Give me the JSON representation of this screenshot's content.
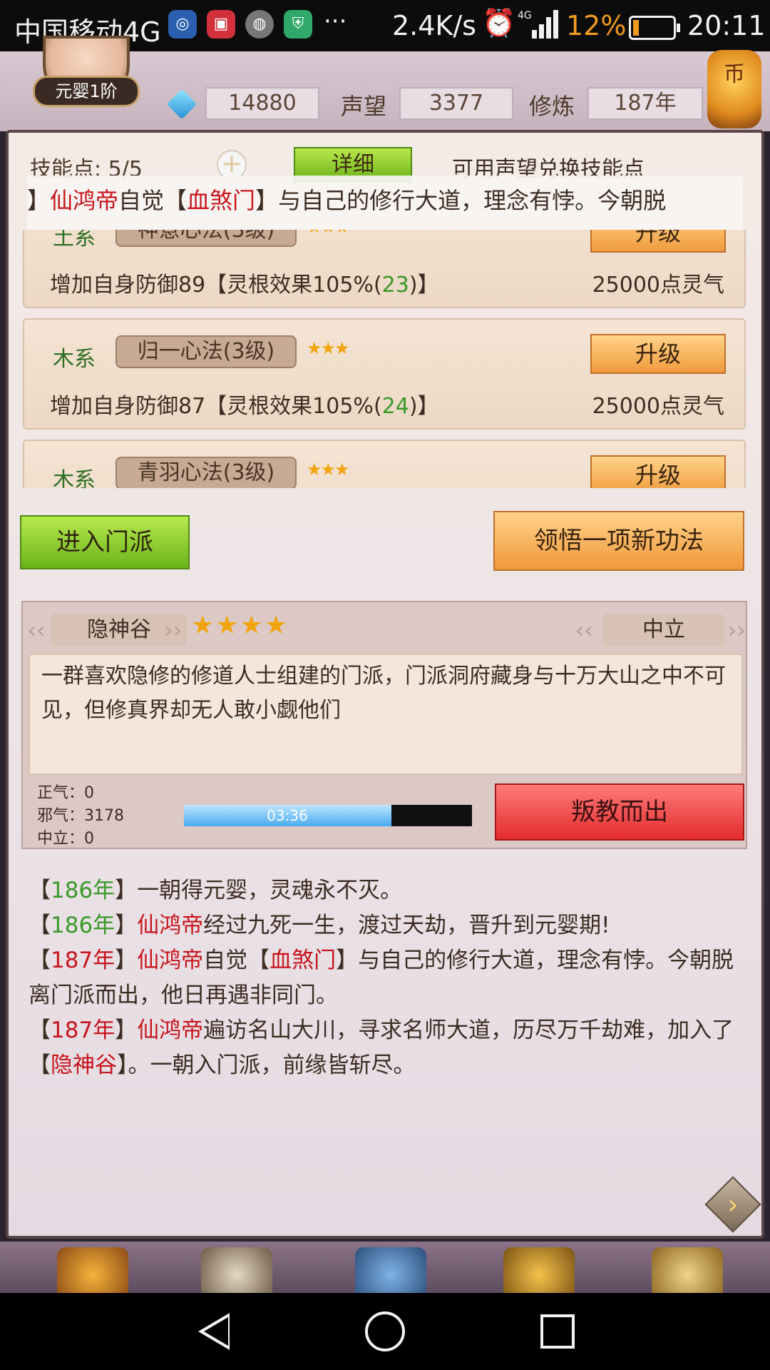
{
  "statusbar": {
    "carrier": "中国移动4G",
    "speed": "2.4K/s",
    "dots": "···",
    "net": "4G",
    "battery": "12%",
    "time": "20:11"
  },
  "topbar": {
    "rank": "元婴1阶",
    "gems": "14880",
    "prestige_label": "声望",
    "prestige": "3377",
    "cultivation_label": "修炼",
    "cultivation": "187年",
    "lantern": "币"
  },
  "skills_header": {
    "points": "技能点: 5/5",
    "detail_button": "详细",
    "exchange": "可用声望兑换技能点"
  },
  "ticker": {
    "lead": "】",
    "name": "仙鸿帝",
    "mid": "自觉【",
    "sect": "血煞门",
    "tail": "】与自己的修行大道，理念有悖。今朝脱"
  },
  "skills": [
    {
      "element": "土系",
      "name": "神意心法(3级)",
      "stars": "★★★",
      "upgrade": "升级",
      "effect_prefix": "增加自身防御89【灵根效果105%(",
      "effect_value": "23",
      "effect_suffix": ")】",
      "cost": "25000点灵气"
    },
    {
      "element": "木系",
      "name": "归一心法(3级)",
      "stars": "★★★",
      "upgrade": "升级",
      "effect_prefix": "增加自身防御87【灵根效果105%(",
      "effect_value": "24",
      "effect_suffix": ")】",
      "cost": "25000点灵气"
    },
    {
      "element": "木系",
      "name": "青羽心法(3级)",
      "stars": "★★★",
      "upgrade": "升级",
      "effect_prefix": "",
      "effect_value": "",
      "effect_suffix": "",
      "cost": ""
    }
  ],
  "actions": {
    "enter_sect": "进入门派",
    "learn": "领悟一项新功法",
    "betray": "叛教而出"
  },
  "sect": {
    "name": "隐神谷",
    "stars": "★★★★",
    "alignment": "中立",
    "description": "一群喜欢隐修的修道人士组建的门派，门派洞府藏身与十万大山之中不可见，但修真界却无人敢小觑他们",
    "righteous": "正气：0",
    "evil": "邪气：3178",
    "neutral": "中立：0",
    "timer": "03:36",
    "timer_progress": 0.72
  },
  "log": [
    {
      "l": "【",
      "year": "186年",
      "r": "】",
      "parts": [
        {
          "t": "一朝得元婴，灵魂永不灭。",
          "c": ""
        }
      ],
      "year_color": "green"
    },
    {
      "l": "【",
      "year": "186年",
      "r": "】",
      "parts": [
        {
          "t": "仙鸿帝",
          "c": "red"
        },
        {
          "t": "经过九死一生，渡过天劫，晋升到元婴期!",
          "c": ""
        }
      ],
      "year_color": "green"
    },
    {
      "l": "【",
      "year": "187年",
      "r": "】",
      "parts": [
        {
          "t": "仙鸿帝",
          "c": "red"
        },
        {
          "t": "自觉【",
          "c": ""
        },
        {
          "t": "血煞门",
          "c": "red"
        },
        {
          "t": "】与自己的修行大道，理念有悖。今朝脱离门派而出，他日再遇非同门。",
          "c": ""
        }
      ],
      "year_color": "red"
    },
    {
      "l": "【",
      "year": "187年",
      "r": "】",
      "parts": [
        {
          "t": "仙鸿帝",
          "c": "red"
        },
        {
          "t": "遍访名山大川，寻求名师大道，历尽万千劫难，加入了【",
          "c": ""
        },
        {
          "t": "隐神谷",
          "c": "red"
        },
        {
          "t": "】。一朝入门派，前缘皆斩尽。",
          "c": ""
        }
      ],
      "year_color": "red"
    }
  ],
  "icons": {
    "next": "chevron-right-icon"
  }
}
